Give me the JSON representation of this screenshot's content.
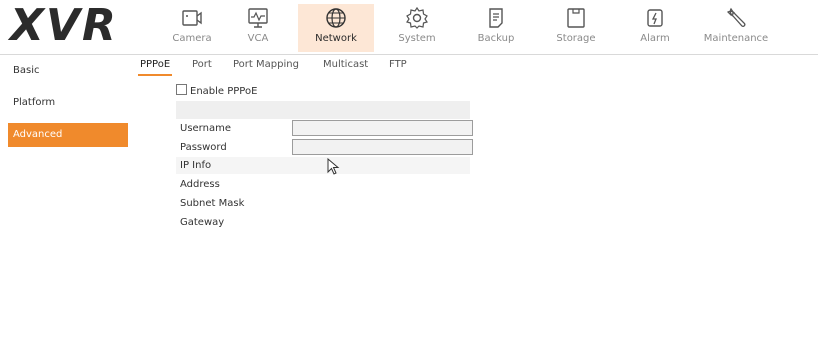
{
  "logo": "XVR",
  "nav": [
    {
      "label": "Camera",
      "icon": "camera-icon"
    },
    {
      "label": "VCA",
      "icon": "vca-monitor-icon"
    },
    {
      "label": "Network",
      "icon": "globe-icon"
    },
    {
      "label": "System",
      "icon": "gear-icon"
    },
    {
      "label": "Backup",
      "icon": "backup-file-icon"
    },
    {
      "label": "Storage",
      "icon": "storage-icon"
    },
    {
      "label": "Alarm",
      "icon": "alarm-icon"
    },
    {
      "label": "Maintenance",
      "icon": "wrench-icon"
    }
  ],
  "active_nav": "Network",
  "accent_color": "#f08a2c",
  "sidebar": {
    "items": [
      {
        "label": "Basic"
      },
      {
        "label": "Platform"
      },
      {
        "label": "Advanced"
      }
    ],
    "active": "Advanced"
  },
  "tabs": [
    {
      "label": "PPPoE"
    },
    {
      "label": "Port"
    },
    {
      "label": "Port Mapping"
    },
    {
      "label": "Multicast"
    },
    {
      "label": "FTP"
    }
  ],
  "active_tab": "PPPoE",
  "form": {
    "enable_label": "Enable PPPoE",
    "enable_checked": false,
    "username_label": "Username",
    "username_value": "",
    "password_label": "Password",
    "password_value": "",
    "ip_info_label": "IP Info",
    "address_label": "Address",
    "subnet_label": "Subnet Mask",
    "gateway_label": "Gateway"
  }
}
